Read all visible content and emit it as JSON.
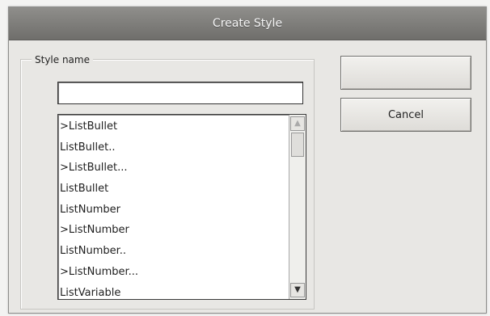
{
  "window": {
    "title": "Create Style"
  },
  "form": {
    "style_name_label": "Style name",
    "style_name_value": ""
  },
  "style_list": {
    "items": [
      ">ListBullet",
      "ListBullet..",
      ">ListBullet...",
      "ListBullet",
      "ListNumber",
      ">ListNumber",
      "ListNumber..",
      ">ListNumber...",
      "ListVariable"
    ],
    "scroll_up_icon": "arrow-up-icon",
    "scroll_down_icon": "arrow-down-icon"
  },
  "buttons": {
    "ok_label": "",
    "cancel_label": "Cancel"
  }
}
